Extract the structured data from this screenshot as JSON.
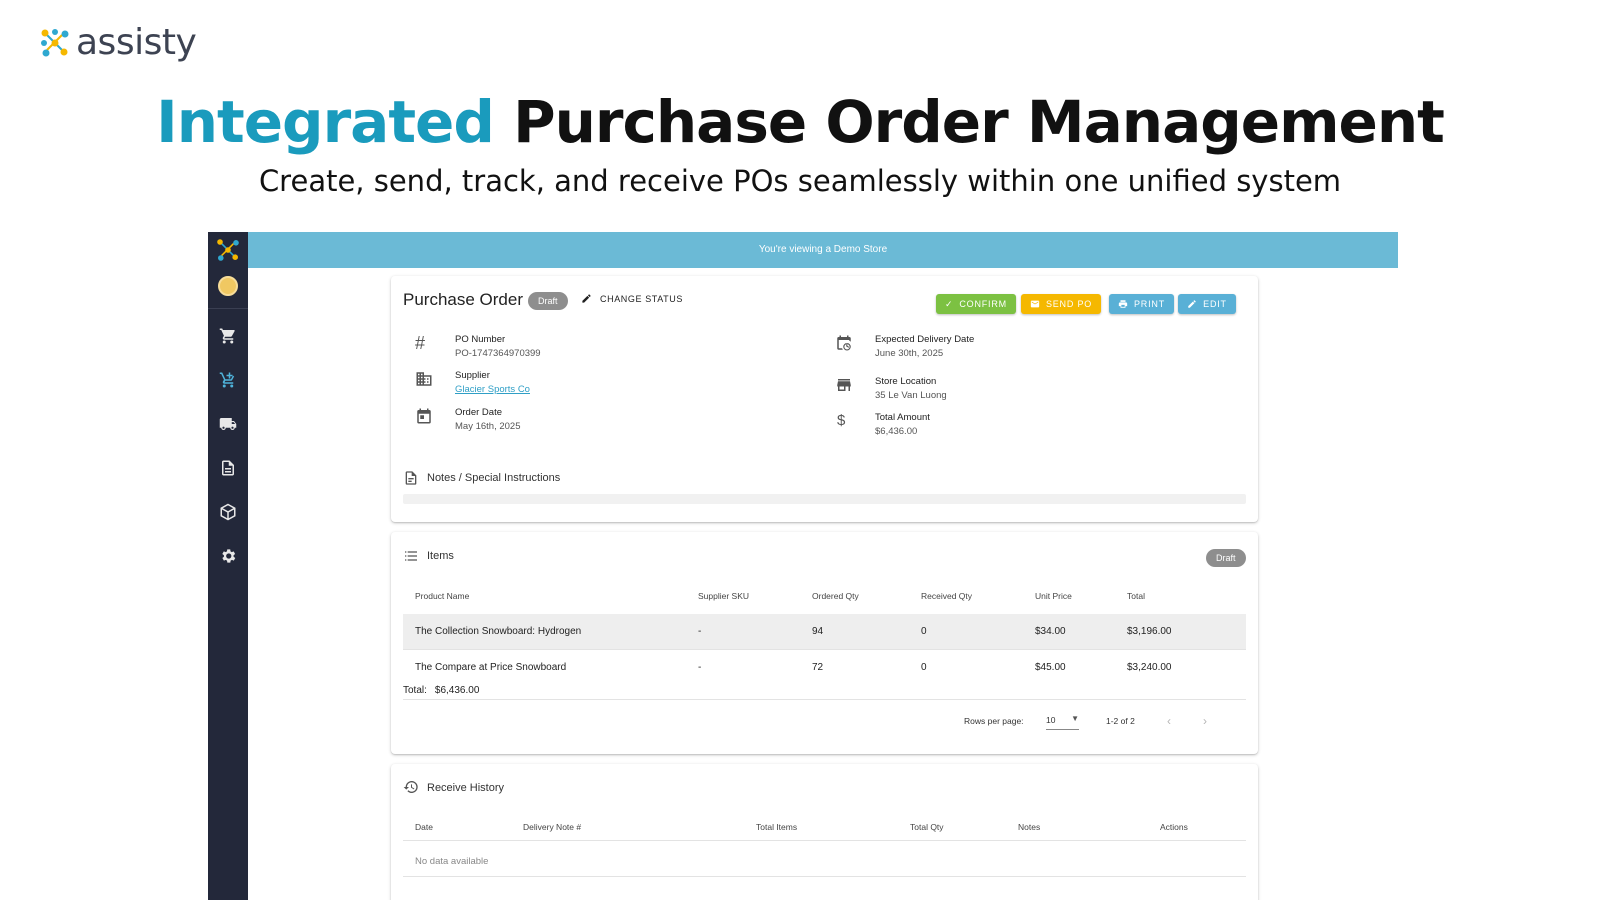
{
  "brand": {
    "name": "assisty",
    "accent_color": "#1a9bbd"
  },
  "hero": {
    "title_accent": "Integrated",
    "title_rest": "Purchase Order Management",
    "subtitle": "Create, send, track, and receive POs seamlessly within one unified system"
  },
  "banner": {
    "text": "You're viewing a Demo Store"
  },
  "sidebar": {
    "items": [
      {
        "icon": "cart-icon"
      },
      {
        "icon": "purchase-order-icon",
        "active": true
      },
      {
        "icon": "truck-icon"
      },
      {
        "icon": "document-icon"
      },
      {
        "icon": "box-icon"
      },
      {
        "icon": "gear-icon"
      }
    ]
  },
  "po": {
    "title": "Purchase Order",
    "status": "Draft",
    "change_status": "CHANGE STATUS",
    "actions": {
      "confirm": "CONFIRM",
      "send": "SEND PO",
      "print": "PRINT",
      "edit": "EDIT"
    },
    "fields": {
      "po_number": {
        "label": "PO Number",
        "value": "PO-1747364970399"
      },
      "supplier": {
        "label": "Supplier",
        "value": "Glacier Sports Co"
      },
      "order_date": {
        "label": "Order Date",
        "value": "May 16th, 2025"
      },
      "expected_delivery": {
        "label": "Expected Delivery Date",
        "value": "June 30th, 2025"
      },
      "store_location": {
        "label": "Store Location",
        "value": "35 Le Van Luong"
      },
      "total_amount": {
        "label": "Total Amount",
        "value": "$6,436.00"
      }
    },
    "notes_label": "Notes / Special Instructions"
  },
  "items": {
    "title": "Items",
    "status": "Draft",
    "columns": [
      "Product Name",
      "Supplier SKU",
      "Ordered Qty",
      "Received Qty",
      "Unit Price",
      "Total"
    ],
    "rows": [
      [
        "The Collection Snowboard: Hydrogen",
        "-",
        "94",
        "0",
        "$34.00",
        "$3,196.00"
      ],
      [
        "The Compare at Price Snowboard",
        "-",
        "72",
        "0",
        "$45.00",
        "$3,240.00"
      ]
    ],
    "total_label": "Total:",
    "total_value": "$6,436.00",
    "pagination": {
      "rows_per_page_label": "Rows per page:",
      "rows_per_page": "10",
      "range": "1-2 of 2"
    }
  },
  "receive_history": {
    "title": "Receive History",
    "columns": [
      "Date",
      "Delivery Note #",
      "Total Items",
      "Total Qty",
      "Notes",
      "Actions"
    ],
    "empty_text": "No data available"
  }
}
